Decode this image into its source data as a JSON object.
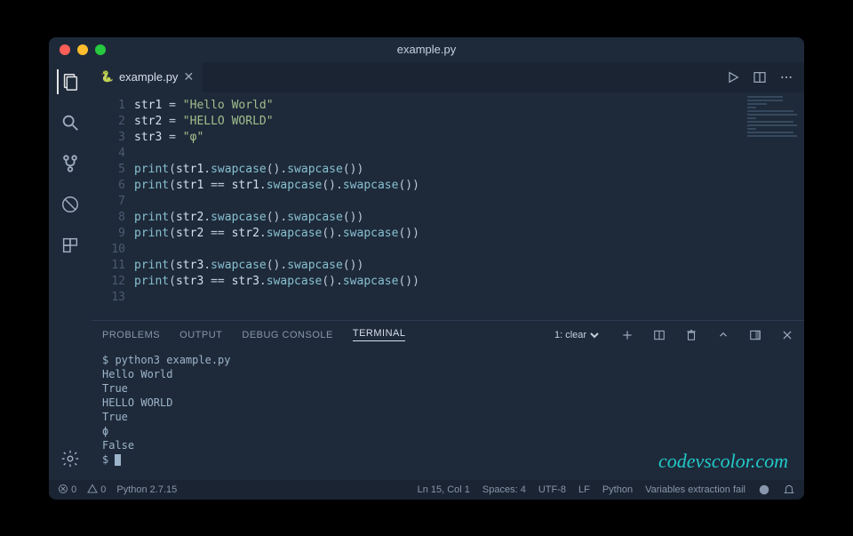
{
  "window": {
    "title": "example.py"
  },
  "tab": {
    "label": "example.py",
    "icon": "python"
  },
  "editor": {
    "lines": [
      {
        "n": 1,
        "tokens": [
          [
            "v",
            "str1"
          ],
          [
            "op",
            " = "
          ],
          [
            "str",
            "\"Hello World\""
          ]
        ]
      },
      {
        "n": 2,
        "tokens": [
          [
            "v",
            "str2"
          ],
          [
            "op",
            " = "
          ],
          [
            "str",
            "\"HELLO WORLD\""
          ]
        ]
      },
      {
        "n": 3,
        "tokens": [
          [
            "v",
            "str3"
          ],
          [
            "op",
            " = "
          ],
          [
            "str",
            "\"φ\""
          ]
        ]
      },
      {
        "n": 4,
        "tokens": []
      },
      {
        "n": 5,
        "tokens": [
          [
            "fn",
            "print"
          ],
          [
            "op",
            "("
          ],
          [
            "v",
            "str1"
          ],
          [
            "op",
            "."
          ],
          [
            "meth",
            "swapcase"
          ],
          [
            "op",
            "()."
          ],
          [
            "meth",
            "swapcase"
          ],
          [
            "op",
            "())"
          ]
        ]
      },
      {
        "n": 6,
        "tokens": [
          [
            "fn",
            "print"
          ],
          [
            "op",
            "("
          ],
          [
            "v",
            "str1"
          ],
          [
            "op",
            " == "
          ],
          [
            "v",
            "str1"
          ],
          [
            "op",
            "."
          ],
          [
            "meth",
            "swapcase"
          ],
          [
            "op",
            "()."
          ],
          [
            "meth",
            "swapcase"
          ],
          [
            "op",
            "())"
          ]
        ]
      },
      {
        "n": 7,
        "tokens": []
      },
      {
        "n": 8,
        "tokens": [
          [
            "fn",
            "print"
          ],
          [
            "op",
            "("
          ],
          [
            "v",
            "str2"
          ],
          [
            "op",
            "."
          ],
          [
            "meth",
            "swapcase"
          ],
          [
            "op",
            "()."
          ],
          [
            "meth",
            "swapcase"
          ],
          [
            "op",
            "())"
          ]
        ]
      },
      {
        "n": 9,
        "tokens": [
          [
            "fn",
            "print"
          ],
          [
            "op",
            "("
          ],
          [
            "v",
            "str2"
          ],
          [
            "op",
            " == "
          ],
          [
            "v",
            "str2"
          ],
          [
            "op",
            "."
          ],
          [
            "meth",
            "swapcase"
          ],
          [
            "op",
            "()."
          ],
          [
            "meth",
            "swapcase"
          ],
          [
            "op",
            "())"
          ]
        ]
      },
      {
        "n": 10,
        "tokens": []
      },
      {
        "n": 11,
        "tokens": [
          [
            "fn",
            "print"
          ],
          [
            "op",
            "("
          ],
          [
            "v",
            "str3"
          ],
          [
            "op",
            "."
          ],
          [
            "meth",
            "swapcase"
          ],
          [
            "op",
            "()."
          ],
          [
            "meth",
            "swapcase"
          ],
          [
            "op",
            "())"
          ]
        ]
      },
      {
        "n": 12,
        "tokens": [
          [
            "fn",
            "print"
          ],
          [
            "op",
            "("
          ],
          [
            "v",
            "str3"
          ],
          [
            "op",
            " == "
          ],
          [
            "v",
            "str3"
          ],
          [
            "op",
            "."
          ],
          [
            "meth",
            "swapcase"
          ],
          [
            "op",
            "()."
          ],
          [
            "meth",
            "swapcase"
          ],
          [
            "op",
            "())"
          ]
        ]
      },
      {
        "n": 13,
        "tokens": []
      }
    ]
  },
  "panel": {
    "tabs": [
      "PROBLEMS",
      "OUTPUT",
      "DEBUG CONSOLE",
      "TERMINAL"
    ],
    "active": "TERMINAL",
    "select": "1: clear",
    "terminal_lines": [
      "$ python3 example.py",
      "Hello World",
      "True",
      "HELLO WORLD",
      "True",
      "ϕ",
      "False",
      "$ "
    ]
  },
  "status": {
    "errors": "0",
    "warnings": "0",
    "python": "Python 2.7.15",
    "cursor": "Ln 15, Col 1",
    "spaces": "Spaces: 4",
    "encoding": "UTF-8",
    "eol": "LF",
    "lang": "Python",
    "msg": "Variables extraction fail"
  },
  "watermark": "codevscolor.com"
}
